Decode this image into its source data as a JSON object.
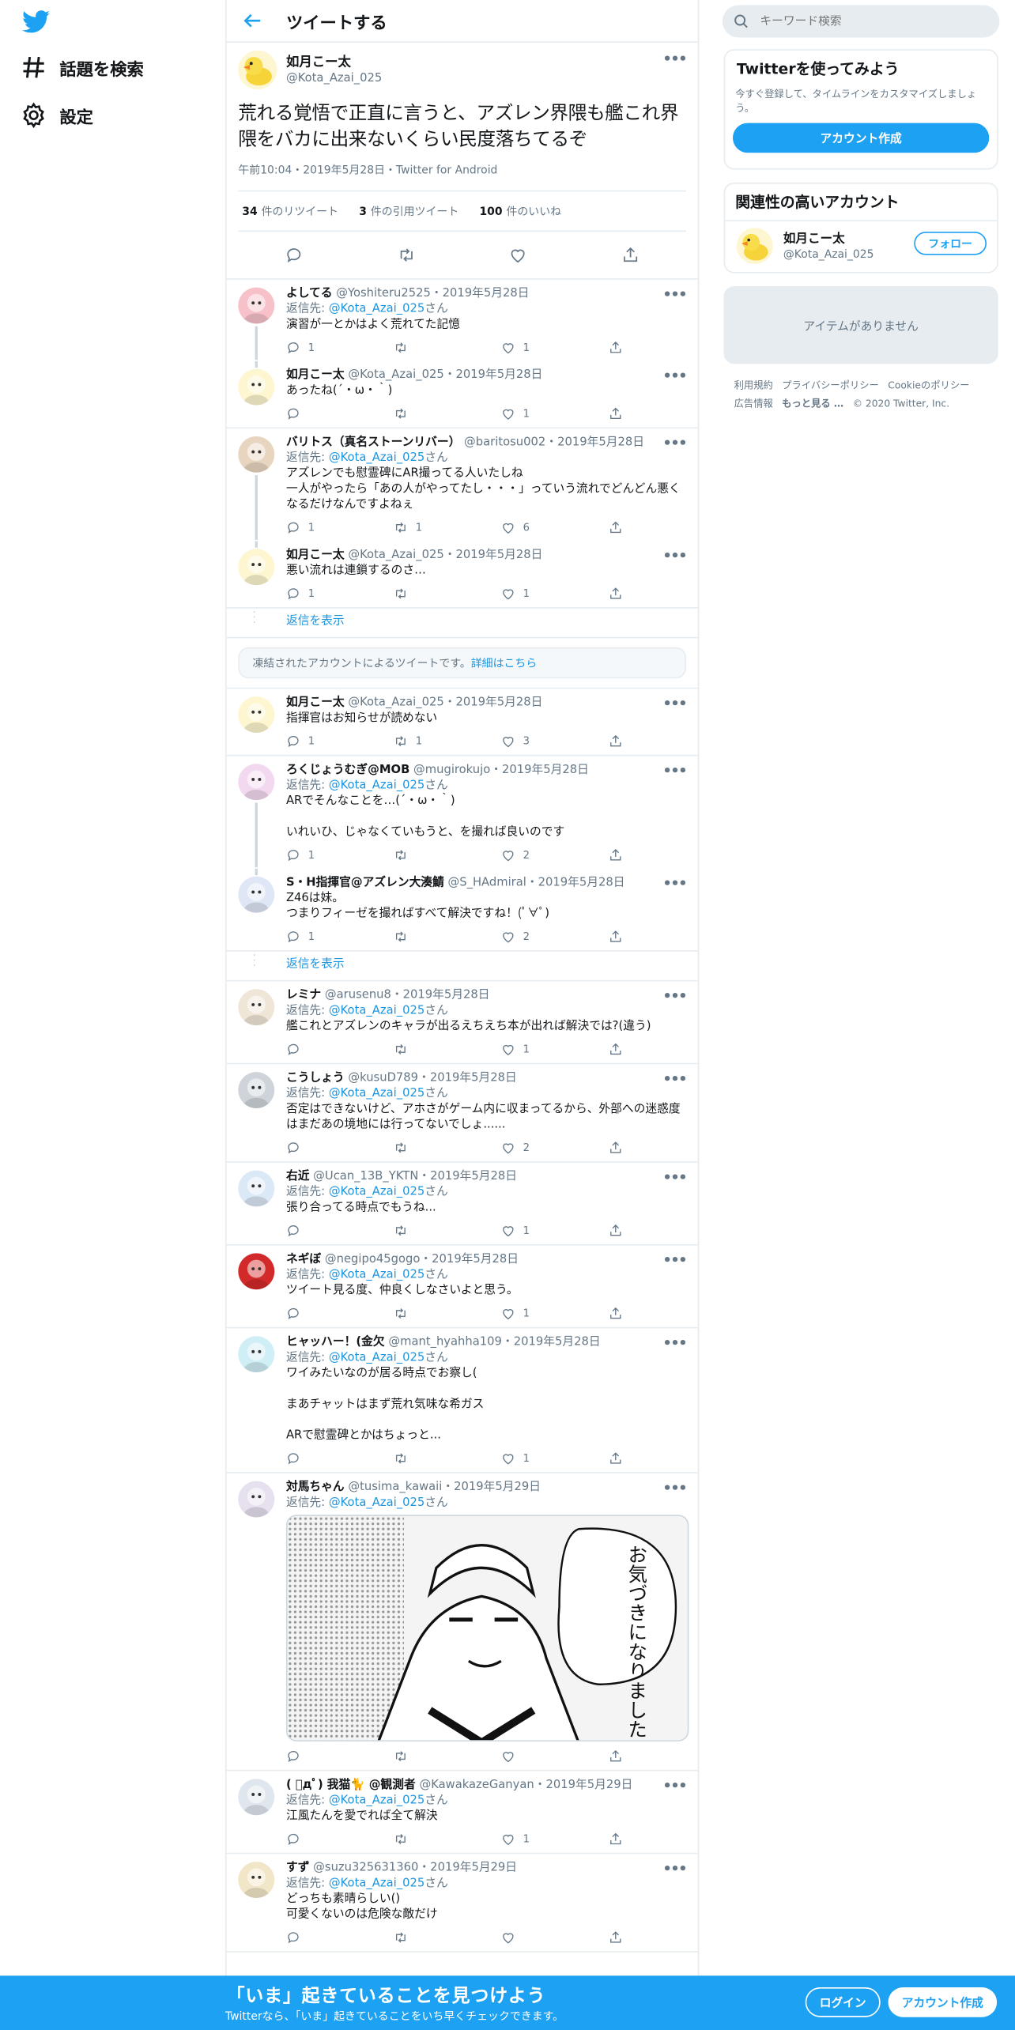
{
  "nav": {
    "explore_label": "話題を検索",
    "settings_label": "設定"
  },
  "header": {
    "title": "ツイートする"
  },
  "focus": {
    "name": "如月こー太",
    "handle": "@Kota_Azai_025",
    "text": "荒れる覚悟で正直に言うと、アズレン界隈も艦これ界隈をバカに出来ないくらい民度落ちてるぞ",
    "meta": "午前10:04・2019年5月28日・Twitter for Android",
    "retweets_count": "34",
    "retweets_label": "件のリツイート",
    "quotes_count": "3",
    "quotes_label": "件の引用ツイート",
    "likes_count": "100",
    "likes_label": "件のいいね"
  },
  "reply_to_label": "返信先:",
  "reply_to_handle": "@Kota_Azai_025",
  "reply_to_suffix": "さん",
  "show_replies": "返信を表示",
  "notice": {
    "text": "凍結されたアカウントによるツイートです。",
    "link": "詳細はこちら"
  },
  "tweets": [
    {
      "name": "よしてる",
      "handle": "@Yoshiteru2525",
      "date": "2019年5月28日",
      "text": "演習が一とかはよく荒れてた記憶",
      "reply": "1",
      "rt": "",
      "like": "1"
    },
    {
      "name": "如月こー太",
      "handle": "@Kota_Azai_025",
      "date": "2019年5月28日",
      "text": "あったね(´・ω・｀)",
      "reply": "",
      "rt": "",
      "like": "1"
    },
    {
      "name": "バリトス（真名ストーンリバー）",
      "handle": "@baritosu002",
      "date": "2019年5月28日",
      "text": "アズレンでも慰霊碑にAR撮ってる人いたしね\n一人がやったら「あの人がやってたし・・・」っていう流れでどんどん悪くなるだけなんですよねぇ",
      "reply": "1",
      "rt": "1",
      "like": "6"
    },
    {
      "name": "如月こー太",
      "handle": "@Kota_Azai_025",
      "date": "2019年5月28日",
      "text": "悪い流れは連鎖するのさ…",
      "reply": "1",
      "rt": "",
      "like": "1"
    },
    {
      "name": "如月こー太",
      "handle": "@Kota_Azai_025",
      "date": "2019年5月28日",
      "text": "指揮官はお知らせが読めない",
      "reply": "1",
      "rt": "1",
      "like": "3"
    },
    {
      "name": "ろくじょうむぎ@MOB",
      "handle": "@mugirokujo",
      "date": "2019年5月28日",
      "text": "ARでそんなことを…(´・ω・｀)\n\nいれいひ、じゃなくていもうと、を撮れば良いのです",
      "reply": "1",
      "rt": "",
      "like": "2"
    },
    {
      "name": "S・H指揮官@アズレン大湊鯖",
      "handle": "@S_HAdmiral",
      "date": "2019年5月28日",
      "text": "Z46は妹。\nつまりフィーゼを撮ればすべて解決ですね！(ﾟ∀ﾟ)",
      "reply": "1",
      "rt": "",
      "like": "2"
    },
    {
      "name": "レミナ",
      "handle": "@arusenu8",
      "date": "2019年5月28日",
      "text": "艦これとアズレンのキャラが出るえちえち本が出れば解決では?(違う)",
      "reply": "",
      "rt": "",
      "like": "1"
    },
    {
      "name": "こうしょう",
      "handle": "@kusuD789",
      "date": "2019年5月28日",
      "text": "否定はできないけど、アホさがゲーム内に収まってるから、外部への迷惑度はまだあの境地には行ってないでしょ......",
      "reply": "",
      "rt": "",
      "like": "2"
    },
    {
      "name": "右近",
      "handle": "@Ucan_13B_YKTN",
      "date": "2019年5月28日",
      "text": "張り合ってる時点でもうね...",
      "reply": "",
      "rt": "",
      "like": "1"
    },
    {
      "name": "ネギぼ",
      "handle": "@negipo45gogo",
      "date": "2019年5月28日",
      "text": "ツイート見る度、仲良くしなさいよと思う。",
      "reply": "",
      "rt": "",
      "like": "1"
    },
    {
      "name": "ヒャッハー！(金欠",
      "handle": "@mant_hyahha109",
      "date": "2019年5月28日",
      "text": "ワイみたいなのが居る時点でお察し(\n\nまあチャットはまず荒れ気味な希ガス\n\nARで慰霊碑とかはちょっと...",
      "reply": "",
      "rt": "",
      "like": "1"
    },
    {
      "name": "対馬ちゃん",
      "handle": "@tusima_kawaii",
      "date": "2019年5月29日",
      "text": "",
      "reply": "",
      "rt": "",
      "like": ""
    },
    {
      "name": "( ﾟдﾟ) 我猫🐈 @観測者",
      "handle": "@KawakazeGanyan",
      "date": "2019年5月29日",
      "text": "江風たんを愛でれば全て解決",
      "reply": "",
      "rt": "",
      "like": "1"
    },
    {
      "name": "すず",
      "handle": "@suzu325631360",
      "date": "2019年5月29日",
      "text": "どっちも素晴らしい()\n可愛くないのは危険な敵だけ",
      "reply": "",
      "rt": "",
      "like": ""
    }
  ],
  "media_text": "お気づきになりましたか",
  "search": {
    "placeholder": "キーワード検索"
  },
  "try_box": {
    "title": "Twitterを使ってみよう",
    "desc": "今すぐ登録して、タイムラインをカスタマイズしましょう。",
    "button": "アカウント作成"
  },
  "related": {
    "title": "関連性の高いアカウント",
    "name": "如月こー太",
    "handle": "@Kota_Azai_025",
    "follow": "フォロー"
  },
  "empty": {
    "text": "アイテムがありません"
  },
  "footer": {
    "links": [
      "利用規約",
      "プライバシーポリシー",
      "Cookieのポリシー",
      "広告情報",
      "もっと見る …",
      "© 2020 Twitter, Inc."
    ]
  },
  "bottom": {
    "title": "「いま」起きていることを見つけよう",
    "subtitle": "Twitterなら、「いま」起きていることをいち早くチェックできます。",
    "login": "ログイン",
    "signup": "アカウント作成"
  },
  "colors": {
    "accent": "#1da1f2",
    "link": "#1b95e0",
    "muted": "#657786",
    "border": "#e6ecf0"
  },
  "icons": [
    "twitter-logo-icon",
    "hashtag-icon",
    "gear-icon",
    "back-arrow-icon",
    "reply-icon",
    "retweet-icon",
    "like-icon",
    "share-icon",
    "more-icon",
    "search-icon"
  ]
}
